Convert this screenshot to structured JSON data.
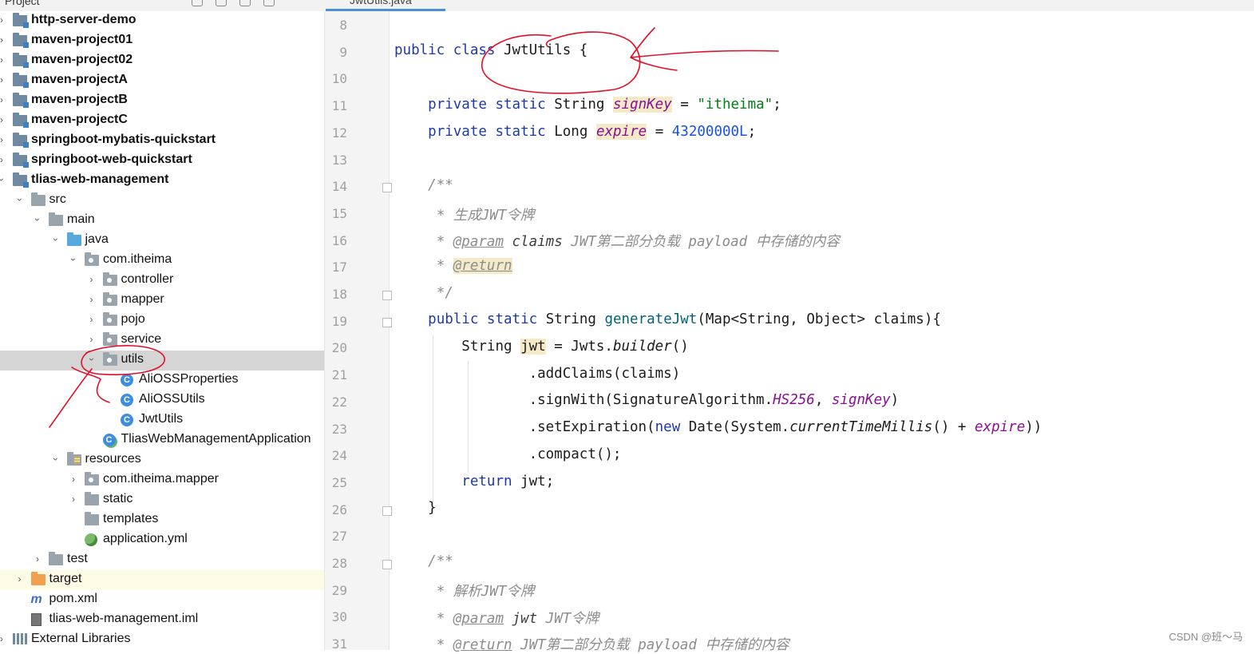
{
  "top_bar": {
    "project_tab": "Project",
    "editor_tab": "JwtUtils.java"
  },
  "tree": [
    {
      "label": "http-server-demo",
      "icon": "module-folder-icon",
      "bold": true
    },
    {
      "label": "maven-project01",
      "icon": "module-folder-icon",
      "bold": true
    },
    {
      "label": "maven-project02",
      "icon": "module-folder-icon",
      "bold": true
    },
    {
      "label": "maven-projectA",
      "icon": "module-folder-icon",
      "bold": true
    },
    {
      "label": "maven-projectB",
      "icon": "module-folder-icon",
      "bold": true
    },
    {
      "label": "maven-projectC",
      "icon": "module-folder-icon",
      "bold": true
    },
    {
      "label": "springboot-mybatis-quickstart",
      "icon": "module-folder-icon",
      "bold": true
    },
    {
      "label": "springboot-web-quickstart",
      "icon": "module-folder-icon",
      "bold": true
    },
    {
      "label": "tlias-web-management",
      "icon": "module-folder-icon",
      "bold": true
    },
    {
      "label": "src",
      "icon": "folder-icon"
    },
    {
      "label": "main",
      "icon": "folder-icon"
    },
    {
      "label": "java",
      "icon": "source-folder-icon"
    },
    {
      "label": "com.itheima",
      "icon": "package-icon"
    },
    {
      "label": "controller",
      "icon": "package-icon"
    },
    {
      "label": "mapper",
      "icon": "package-icon"
    },
    {
      "label": "pojo",
      "icon": "package-icon"
    },
    {
      "label": "service",
      "icon": "package-icon"
    },
    {
      "label": "utils",
      "icon": "package-icon"
    },
    {
      "label": "AliOSSProperties",
      "icon": "class-icon"
    },
    {
      "label": "AliOSSUtils",
      "icon": "class-icon"
    },
    {
      "label": "JwtUtils",
      "icon": "class-icon"
    },
    {
      "label": "TliasWebManagementApplication",
      "icon": "spring-app-class-icon"
    },
    {
      "label": "resources",
      "icon": "resources-folder-icon"
    },
    {
      "label": "com.itheima.mapper",
      "icon": "package-icon"
    },
    {
      "label": "static",
      "icon": "folder-icon"
    },
    {
      "label": "templates",
      "icon": "folder-icon"
    },
    {
      "label": "application.yml",
      "icon": "yaml-file-icon"
    },
    {
      "label": "test",
      "icon": "folder-icon"
    },
    {
      "label": "target",
      "icon": "excluded-folder-icon"
    },
    {
      "label": "pom.xml",
      "icon": "maven-file-icon"
    },
    {
      "label": "tlias-web-management.iml",
      "icon": "iml-file-icon"
    },
    {
      "label": "External Libraries",
      "icon": "library-icon"
    }
  ],
  "line_numbers": [
    "8",
    "9",
    "10",
    "11",
    "12",
    "13",
    "14",
    "15",
    "16",
    "17",
    "18",
    "19",
    "20",
    "21",
    "22",
    "23",
    "24",
    "25",
    "26",
    "27",
    "28",
    "29",
    "30",
    "31"
  ],
  "code": {
    "l9": {
      "kw1": "public",
      "kw2": "class",
      "name": " JwtUtils {"
    },
    "l11": {
      "kw1": "private",
      "kw2": "static",
      "type": "String",
      "fld": "signKey",
      "eq": " = ",
      "str": "\"itheima\"",
      "end": ";"
    },
    "l12": {
      "kw1": "private",
      "kw2": "static",
      "type": "Long",
      "fld": "expire",
      "eq": " = ",
      "num": "43200000L",
      "end": ";"
    },
    "l14": {
      "cmt": "/**"
    },
    "l15": {
      "cmt": " * 生成JWT令牌"
    },
    "l16": {
      "star": " * ",
      "tag": "@param",
      "param": " claims",
      "cmt": " JWT第二部分负载 payload 中存储的内容"
    },
    "l17": {
      "star": " * ",
      "tag": "@return"
    },
    "l18": {
      "cmt": " */"
    },
    "l19": {
      "kw1": "public",
      "kw2": "static",
      "type": "String",
      "mth": "generateJwt",
      "rest": "(Map<String, Object> claims){"
    },
    "l20": {
      "type": "String",
      "var": "jwt",
      "eq": " = Jwts.",
      "stat": "builder",
      "end": "()"
    },
    "l21": {
      "text": ".addClaims(claims)"
    },
    "l22": {
      "pre": ".signWith(SignatureAlgorithm.",
      "fld1": "HS256",
      "mid": ", ",
      "fld2": "signKey",
      "end": ")"
    },
    "l23": {
      "pre": ".setExpiration(",
      "kw": "new",
      "mid": " Date(System.",
      "stat": "currentTimeMillis",
      "mid2": "() + ",
      "fld": "expire",
      "end": "))"
    },
    "l24": {
      "text": ".compact();"
    },
    "l25": {
      "kw": "return",
      "rest": " jwt;"
    },
    "l26": {
      "text": "}"
    },
    "l28": {
      "cmt": "/**"
    },
    "l29": {
      "cmt": " * 解析JWT令牌"
    },
    "l30": {
      "star": " * ",
      "tag": "@param",
      "param": " jwt",
      "cmt": " JWT令牌"
    },
    "l31": {
      "star": " * ",
      "tag": "@return",
      "cmt": " JWT第二部分负载 payload 中存储的内容"
    }
  },
  "watermark": "CSDN @班～马",
  "colors": {
    "keyword": "#1f3aa0",
    "field": "#871094",
    "string": "#067d17",
    "number": "#1750eb",
    "comment": "#8c8c8c",
    "annotation_ink": "#e0102a",
    "tab_accent": "#4a8fd9"
  }
}
